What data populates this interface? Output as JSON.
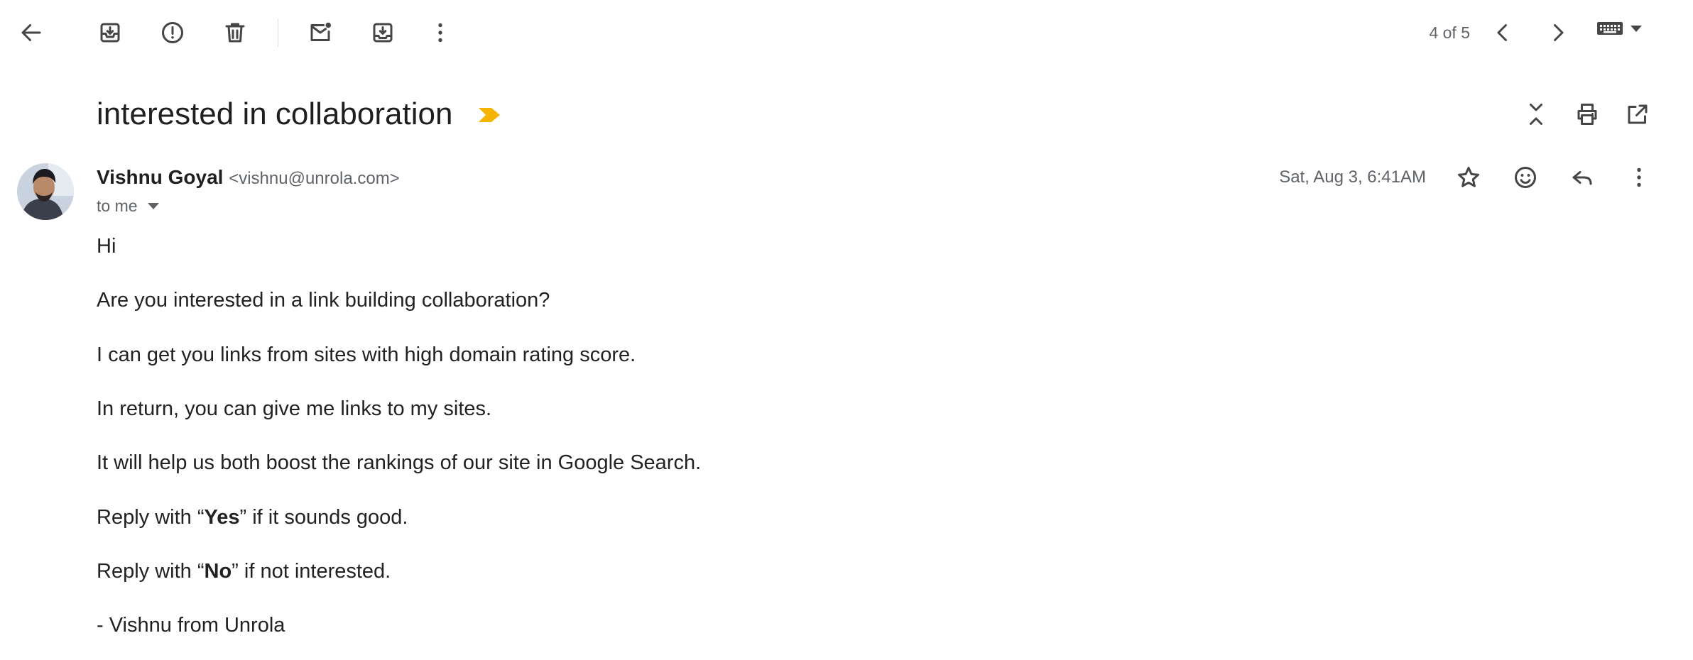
{
  "toolbar": {
    "counter": "4 of 5"
  },
  "email": {
    "subject": "interested in collaboration",
    "sender_name": "Vishnu Goyal",
    "sender_email": "<vishnu@unrola.com>",
    "recipient": "to me",
    "date": "Sat, Aug 3, 6:41AM"
  },
  "body": {
    "greeting": "Hi",
    "p1": "Are you interested in a link building collaboration?",
    "p2": "I can get you links from sites with high domain rating score.",
    "p3": "In return, you can give me links to my sites.",
    "p4": "It will help us both boost the rankings of our site in Google Search.",
    "yes_prefix": "Reply with “",
    "yes_word": "Yes",
    "yes_suffix": "” if it sounds good.",
    "no_prefix": "Reply with “",
    "no_word": "No",
    "no_suffix": "” if not interested.",
    "signature": "- Vishnu from Unrola"
  },
  "colors": {
    "important_marker": "#f4b400",
    "text_primary": "#1f1f1f",
    "text_secondary": "#5f6368"
  }
}
